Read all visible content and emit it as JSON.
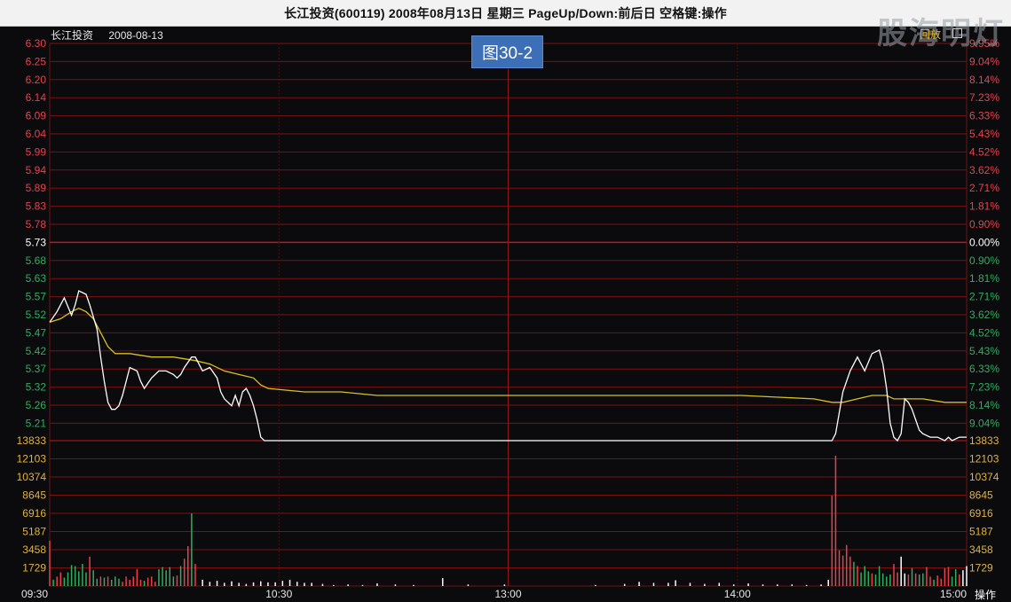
{
  "window": {
    "title": "长江投资(600119) 2008年08月13日 星期三 PageUp/Down:前后日 空格键:操作"
  },
  "header": {
    "stock_name": "长江投资",
    "date": "2008-08-13",
    "figure_label": "图30-2",
    "watermark": "股海明灯",
    "replay_label": "回放",
    "operate_label": "操作"
  },
  "colors": {
    "up": "#e8414b",
    "down": "#2fae5e",
    "flat": "#ffffff",
    "grid": "#7a1010",
    "price_line": "#ffffff",
    "avg_line": "#d8c020",
    "volume_axis": "#e2b23a"
  },
  "chart_data": {
    "type": "line",
    "title": "",
    "prev_close": 5.73,
    "price_ticks_up": [
      "6.30",
      "6.25",
      "6.20",
      "6.14",
      "6.09",
      "6.04",
      "5.99",
      "5.94",
      "5.89",
      "5.83",
      "5.78"
    ],
    "price_tick_mid": "5.73",
    "price_ticks_down": [
      "5.68",
      "5.63",
      "5.57",
      "5.52",
      "5.47",
      "5.42",
      "5.37",
      "5.32",
      "5.26",
      "5.21"
    ],
    "pct_ticks_up": [
      "9.95%",
      "9.04%",
      "8.14%",
      "7.23%",
      "6.33%",
      "5.43%",
      "4.52%",
      "3.62%",
      "2.71%",
      "1.81%",
      "0.90%"
    ],
    "pct_tick_mid": "0.00%",
    "pct_ticks_down": [
      "0.90%",
      "1.81%",
      "2.71%",
      "3.62%",
      "4.52%",
      "5.43%",
      "6.33%",
      "7.23%",
      "8.14%",
      "9.04%"
    ],
    "volume_ticks": [
      "13833",
      "12103",
      "10374",
      "8645",
      "6916",
      "5187",
      "3458",
      "1729"
    ],
    "time_labels": [
      "09:30",
      "10:30",
      "13:00",
      "14:00",
      "15:00"
    ],
    "y_min": 5.16,
    "y_max": 6.3,
    "x_minutes": 240,
    "price_series": {
      "name": "",
      "points": [
        [
          0,
          5.5
        ],
        [
          2,
          5.53
        ],
        [
          4,
          5.57
        ],
        [
          6,
          5.52
        ],
        [
          7,
          5.55
        ],
        [
          8,
          5.59
        ],
        [
          10,
          5.58
        ],
        [
          11,
          5.55
        ],
        [
          13,
          5.48
        ],
        [
          14,
          5.4
        ],
        [
          15,
          5.33
        ],
        [
          16,
          5.27
        ],
        [
          17,
          5.25
        ],
        [
          18,
          5.25
        ],
        [
          19,
          5.26
        ],
        [
          20,
          5.29
        ],
        [
          22,
          5.37
        ],
        [
          24,
          5.36
        ],
        [
          25,
          5.33
        ],
        [
          26,
          5.31
        ],
        [
          28,
          5.34
        ],
        [
          30,
          5.36
        ],
        [
          32,
          5.36
        ],
        [
          34,
          5.35
        ],
        [
          35,
          5.34
        ],
        [
          36,
          5.35
        ],
        [
          37,
          5.37
        ],
        [
          39,
          5.4
        ],
        [
          40,
          5.4
        ],
        [
          41,
          5.38
        ],
        [
          42,
          5.36
        ],
        [
          44,
          5.37
        ],
        [
          46,
          5.34
        ],
        [
          47,
          5.3
        ],
        [
          48,
          5.28
        ],
        [
          50,
          5.26
        ],
        [
          51,
          5.29
        ],
        [
          52,
          5.26
        ],
        [
          53,
          5.3
        ],
        [
          54,
          5.31
        ],
        [
          55,
          5.29
        ],
        [
          56,
          5.26
        ],
        [
          57,
          5.22
        ],
        [
          58,
          5.17
        ],
        [
          59,
          5.16
        ],
        [
          100,
          5.16
        ],
        [
          170,
          5.16
        ],
        [
          215,
          5.16
        ],
        [
          216,
          5.18
        ],
        [
          218,
          5.3
        ],
        [
          220,
          5.36
        ],
        [
          222,
          5.4
        ],
        [
          224,
          5.36
        ],
        [
          226,
          5.41
        ],
        [
          228,
          5.42
        ],
        [
          229,
          5.38
        ],
        [
          230,
          5.31
        ],
        [
          231,
          5.21
        ],
        [
          232,
          5.17
        ],
        [
          233,
          5.16
        ],
        [
          234,
          5.18
        ],
        [
          235,
          5.28
        ],
        [
          236,
          5.27
        ],
        [
          237,
          5.25
        ],
        [
          238,
          5.22
        ],
        [
          239,
          5.19
        ],
        [
          240,
          5.18
        ],
        [
          242,
          5.17
        ],
        [
          244,
          5.17
        ],
        [
          246,
          5.16
        ],
        [
          247,
          5.17
        ],
        [
          248,
          5.16
        ],
        [
          250,
          5.17
        ],
        [
          252,
          5.17
        ]
      ]
    },
    "avg_series": {
      "name": "",
      "points": [
        [
          0,
          5.5
        ],
        [
          3,
          5.51
        ],
        [
          6,
          5.53
        ],
        [
          8,
          5.54
        ],
        [
          10,
          5.53
        ],
        [
          12,
          5.51
        ],
        [
          14,
          5.47
        ],
        [
          16,
          5.43
        ],
        [
          18,
          5.41
        ],
        [
          22,
          5.41
        ],
        [
          28,
          5.4
        ],
        [
          34,
          5.4
        ],
        [
          40,
          5.39
        ],
        [
          44,
          5.38
        ],
        [
          48,
          5.36
        ],
        [
          52,
          5.35
        ],
        [
          56,
          5.34
        ],
        [
          58,
          5.32
        ],
        [
          60,
          5.31
        ],
        [
          70,
          5.3
        ],
        [
          80,
          5.3
        ],
        [
          90,
          5.29
        ],
        [
          100,
          5.29
        ],
        [
          130,
          5.29
        ],
        [
          160,
          5.29
        ],
        [
          190,
          5.29
        ],
        [
          210,
          5.28
        ],
        [
          215,
          5.27
        ],
        [
          218,
          5.27
        ],
        [
          222,
          5.28
        ],
        [
          226,
          5.29
        ],
        [
          230,
          5.29
        ],
        [
          232,
          5.28
        ],
        [
          236,
          5.28
        ],
        [
          240,
          5.28
        ],
        [
          246,
          5.27
        ],
        [
          252,
          5.27
        ]
      ]
    },
    "volume_bars": [
      [
        0,
        4300,
        "up"
      ],
      [
        1,
        600,
        "down"
      ],
      [
        2,
        900,
        "up"
      ],
      [
        3,
        1300,
        "up"
      ],
      [
        4,
        800,
        "down"
      ],
      [
        5,
        1300,
        "down"
      ],
      [
        6,
        2000,
        "down"
      ],
      [
        7,
        1900,
        "down"
      ],
      [
        8,
        1400,
        "down"
      ],
      [
        9,
        2100,
        "down"
      ],
      [
        10,
        1300,
        "down"
      ],
      [
        11,
        2800,
        "up"
      ],
      [
        12,
        1500,
        "down"
      ],
      [
        13,
        700,
        "down"
      ],
      [
        14,
        900,
        "up"
      ],
      [
        15,
        800,
        "down"
      ],
      [
        16,
        900,
        "up"
      ],
      [
        17,
        600,
        "down"
      ],
      [
        18,
        900,
        "down"
      ],
      [
        19,
        700,
        "down"
      ],
      [
        20,
        400,
        "up"
      ],
      [
        21,
        900,
        "up"
      ],
      [
        22,
        600,
        "up"
      ],
      [
        23,
        900,
        "up"
      ],
      [
        24,
        1600,
        "up"
      ],
      [
        25,
        600,
        "up"
      ],
      [
        26,
        500,
        "down"
      ],
      [
        27,
        800,
        "up"
      ],
      [
        28,
        900,
        "up"
      ],
      [
        29,
        400,
        "up"
      ],
      [
        30,
        1600,
        "down"
      ],
      [
        31,
        1800,
        "down"
      ],
      [
        32,
        1500,
        "down"
      ],
      [
        33,
        1800,
        "down"
      ],
      [
        34,
        900,
        "down"
      ],
      [
        35,
        1000,
        "up"
      ],
      [
        36,
        1900,
        "down"
      ],
      [
        37,
        2600,
        "up"
      ],
      [
        38,
        3800,
        "up"
      ],
      [
        39,
        6900,
        "down"
      ],
      [
        40,
        2100,
        "up"
      ],
      [
        42,
        600,
        "flat"
      ],
      [
        44,
        400,
        "flat"
      ],
      [
        46,
        500,
        "flat"
      ],
      [
        48,
        300,
        "flat"
      ],
      [
        50,
        450,
        "flat"
      ],
      [
        52,
        300,
        "flat"
      ],
      [
        54,
        200,
        "flat"
      ],
      [
        56,
        350,
        "flat"
      ],
      [
        58,
        450,
        "flat"
      ],
      [
        60,
        350,
        "flat"
      ],
      [
        62,
        350,
        "flat"
      ],
      [
        64,
        500,
        "flat"
      ],
      [
        66,
        600,
        "flat"
      ],
      [
        68,
        400,
        "flat"
      ],
      [
        70,
        300,
        "flat"
      ],
      [
        72,
        300,
        "flat"
      ],
      [
        75,
        200,
        "flat"
      ],
      [
        78,
        100,
        "flat"
      ],
      [
        82,
        150,
        "flat"
      ],
      [
        86,
        100,
        "flat"
      ],
      [
        90,
        250,
        "flat"
      ],
      [
        95,
        150,
        "flat"
      ],
      [
        100,
        100,
        "flat"
      ],
      [
        108,
        750,
        "flat"
      ],
      [
        115,
        150,
        "flat"
      ],
      [
        125,
        150,
        "flat"
      ],
      [
        150,
        100,
        "flat"
      ],
      [
        158,
        200,
        "flat"
      ],
      [
        162,
        400,
        "flat"
      ],
      [
        166,
        300,
        "flat"
      ],
      [
        170,
        300,
        "flat"
      ],
      [
        172,
        550,
        "flat"
      ],
      [
        176,
        300,
        "flat"
      ],
      [
        180,
        200,
        "flat"
      ],
      [
        184,
        300,
        "flat"
      ],
      [
        188,
        150,
        "flat"
      ],
      [
        192,
        250,
        "flat"
      ],
      [
        196,
        150,
        "flat"
      ],
      [
        200,
        150,
        "flat"
      ],
      [
        204,
        150,
        "flat"
      ],
      [
        208,
        100,
        "flat"
      ],
      [
        212,
        150,
        "flat"
      ],
      [
        214,
        600,
        "flat"
      ],
      [
        215,
        8600,
        "up"
      ],
      [
        216,
        12400,
        "up"
      ],
      [
        217,
        3400,
        "up"
      ],
      [
        218,
        2900,
        "up"
      ],
      [
        219,
        3900,
        "up"
      ],
      [
        220,
        2800,
        "up"
      ],
      [
        221,
        2300,
        "down"
      ],
      [
        222,
        1900,
        "up"
      ],
      [
        223,
        1300,
        "down"
      ],
      [
        224,
        1900,
        "down"
      ],
      [
        225,
        1400,
        "down"
      ],
      [
        226,
        1200,
        "up"
      ],
      [
        227,
        1100,
        "down"
      ],
      [
        228,
        1900,
        "down"
      ],
      [
        229,
        1200,
        "down"
      ],
      [
        230,
        900,
        "down"
      ],
      [
        231,
        1100,
        "down"
      ],
      [
        232,
        2100,
        "up"
      ],
      [
        233,
        1300,
        "up"
      ],
      [
        234,
        2800,
        "flat"
      ],
      [
        235,
        1200,
        "flat"
      ],
      [
        236,
        1100,
        "up"
      ],
      [
        237,
        1700,
        "down"
      ],
      [
        238,
        1200,
        "up"
      ],
      [
        239,
        1100,
        "down"
      ],
      [
        240,
        1200,
        "down"
      ],
      [
        241,
        1800,
        "up"
      ],
      [
        242,
        900,
        "up"
      ],
      [
        243,
        600,
        "down"
      ],
      [
        244,
        1000,
        "up"
      ],
      [
        245,
        700,
        "up"
      ],
      [
        246,
        1700,
        "up"
      ],
      [
        247,
        1800,
        "up"
      ],
      [
        248,
        900,
        "down"
      ],
      [
        249,
        1600,
        "down"
      ],
      [
        250,
        1100,
        "up"
      ],
      [
        251,
        1500,
        "flat"
      ],
      [
        252,
        1900,
        "flat"
      ]
    ]
  }
}
